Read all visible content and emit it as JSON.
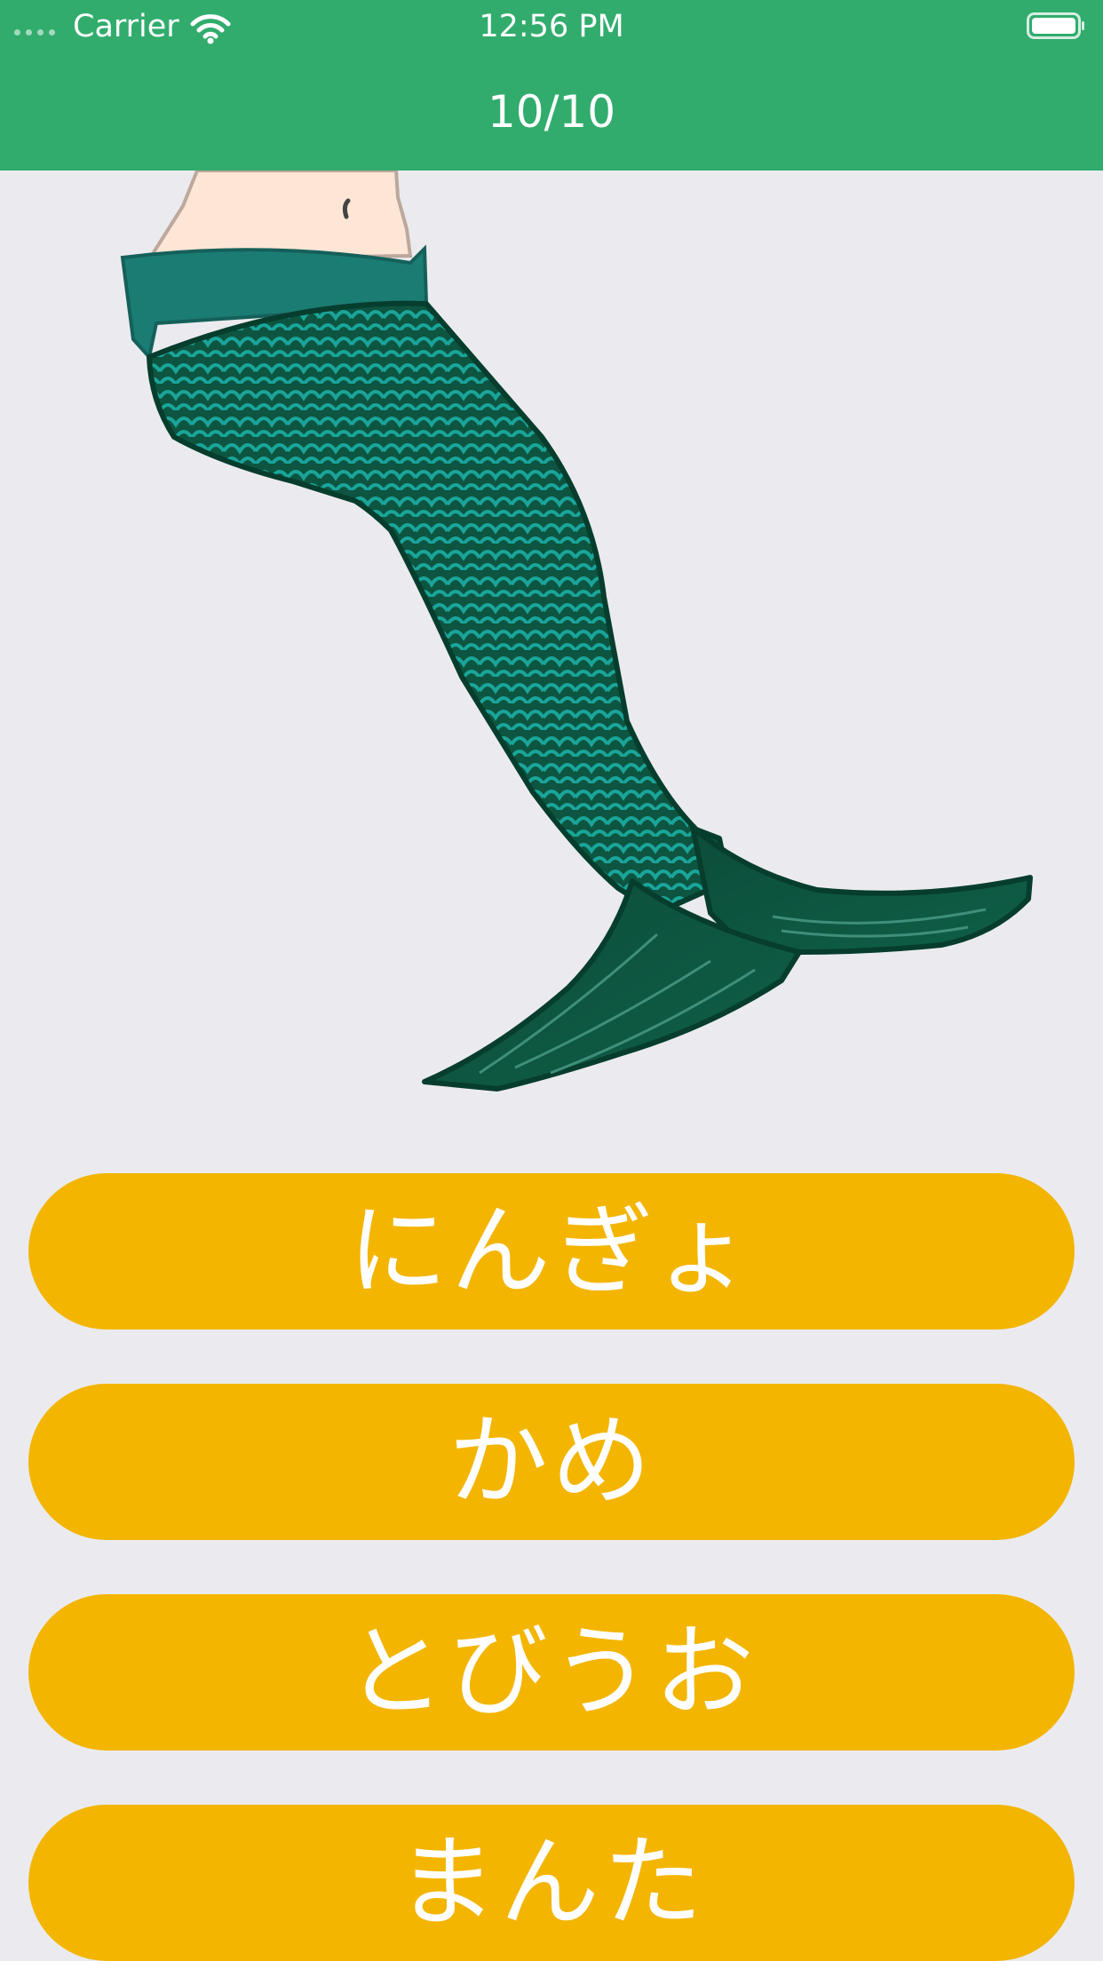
{
  "status_bar": {
    "carrier": "Carrier",
    "time": "12:56 PM",
    "icons": [
      "signal-dots-icon",
      "wifi-icon",
      "battery-icon"
    ]
  },
  "nav": {
    "title": "10/10"
  },
  "illustration": {
    "subject": "mermaid-tail-illustration"
  },
  "answers": [
    {
      "label": "にんぎょ"
    },
    {
      "label": "かめ"
    },
    {
      "label": "とびうお"
    },
    {
      "label": "まんた"
    }
  ],
  "colors": {
    "header": "#31ac6d",
    "background": "#ebebef",
    "button": "#f3b500",
    "button_text": "#ffffff",
    "tail_dark": "#0d5540",
    "tail_scales": "#1aa59a",
    "skin": "#fde6d6"
  }
}
